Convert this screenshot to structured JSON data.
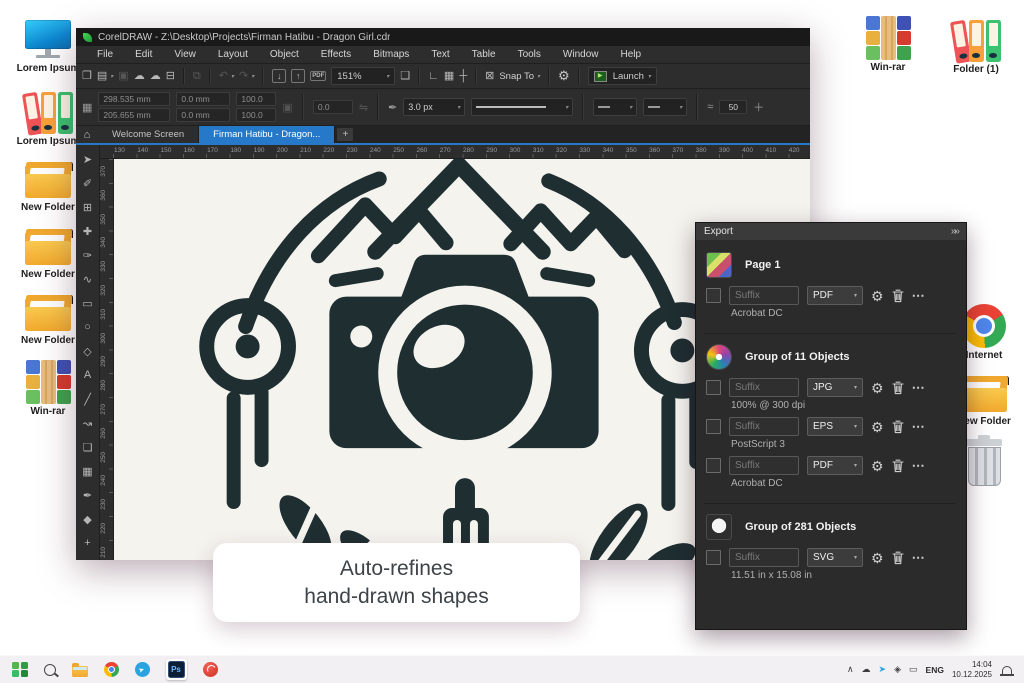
{
  "colors": {
    "artwork": "#1e2e31",
    "canvas_bg": "#f4f3ee",
    "accent_blue": "#2579c8",
    "active_tab": "#2579c8"
  },
  "desktop": {
    "left_icons": [
      {
        "type": "monitor",
        "label": "Lorem Ipsum"
      },
      {
        "type": "binders",
        "label": "Lorem Ipsum"
      },
      {
        "type": "folder",
        "label": "New Folder"
      },
      {
        "type": "folder",
        "label": "New Folder"
      },
      {
        "type": "folder",
        "label": "New Folder"
      },
      {
        "type": "winrar",
        "label": "Win-rar"
      }
    ],
    "top_right_icons": [
      {
        "type": "winrar",
        "label": "Win-rar"
      },
      {
        "type": "binders",
        "label": "Folder (1)"
      }
    ],
    "right_icons": [
      {
        "type": "chrome",
        "label": "Internet"
      },
      {
        "type": "folder",
        "label": "New Folder"
      },
      {
        "type": "trash",
        "label": ""
      }
    ]
  },
  "corel": {
    "title": "CorelDRAW - Z:\\Desktop\\Projects\\Firman Hatibu - Dragon Girl.cdr",
    "menu_items": [
      "File",
      "Edit",
      "View",
      "Layout",
      "Object",
      "Effects",
      "Bitmaps",
      "Text",
      "Table",
      "Tools",
      "Window",
      "Help"
    ],
    "toolbar_icons_left": [
      {
        "name": "new-document-icon",
        "glyph": "❐"
      },
      {
        "name": "open-icon",
        "glyph": "▤",
        "caret": true
      },
      {
        "name": "save-icon",
        "glyph": "▣",
        "dim": true
      },
      {
        "name": "cloud-upload-icon",
        "glyph": "☁"
      },
      {
        "name": "cloud-download-icon",
        "glyph": "☁"
      },
      {
        "name": "print-icon",
        "glyph": "⊟"
      },
      {
        "name": "sep"
      },
      {
        "name": "copy-icon",
        "glyph": "⧉",
        "dim": true
      },
      {
        "name": "sep"
      },
      {
        "name": "undo-icon",
        "glyph": "↶",
        "dim": true,
        "caret": true
      },
      {
        "name": "redo-icon",
        "glyph": "↷",
        "dim": true,
        "caret": true
      },
      {
        "name": "sep"
      },
      {
        "name": "import-icon",
        "glyph": "↓",
        "boxed": true
      },
      {
        "name": "export-icon",
        "glyph": "↑",
        "boxed": true
      },
      {
        "name": "pdf-share-icon",
        "glyph": "PDF",
        "pdf": true
      }
    ],
    "toolbar_icons_view": [
      {
        "name": "fullscreen-icon",
        "glyph": "❑"
      },
      {
        "name": "sep"
      },
      {
        "name": "rulers-toggle-icon",
        "glyph": "∟"
      },
      {
        "name": "grid-toggle-icon",
        "glyph": "▦"
      },
      {
        "name": "guidelines-toggle-icon",
        "glyph": "┼"
      },
      {
        "name": "sep"
      },
      {
        "name": "snap-off-icon",
        "glyph": "⊠"
      }
    ],
    "toolbar": {
      "zoom_level": "151%",
      "snap_label": "Snap To",
      "launch_label": "Launch"
    },
    "property_bar": {
      "object_pos_x": "298.535 mm",
      "object_pos_y": "205.655 mm",
      "object_size_w": "0.0 mm",
      "object_size_h": "0.0 mm",
      "scale_x": "100.0",
      "scale_y": "100.0",
      "rotation_angle": "0.0",
      "outline_width": "3.0 px",
      "smoothing_value": "50"
    },
    "tabs": {
      "welcome": "Welcome Screen",
      "document": "Firman Hatibu - Dragon..."
    },
    "toolbox": [
      {
        "name": "pick-tool",
        "glyph": "➤"
      },
      {
        "name": "shape-tool",
        "glyph": "✐"
      },
      {
        "name": "crop-tool",
        "glyph": "⊞"
      },
      {
        "name": "pan-tool",
        "glyph": "✚"
      },
      {
        "name": "freehand-tool",
        "glyph": "✑"
      },
      {
        "name": "curve-tool",
        "glyph": "∿"
      },
      {
        "name": "rectangle-tool",
        "glyph": "▭"
      },
      {
        "name": "ellipse-tool",
        "glyph": "○"
      },
      {
        "name": "polygon-tool",
        "glyph": "◇"
      },
      {
        "name": "text-tool",
        "glyph": "A"
      },
      {
        "name": "line-tool",
        "glyph": "╱"
      },
      {
        "name": "connector-tool",
        "glyph": "↝"
      },
      {
        "name": "shadow-tool",
        "glyph": "❏"
      },
      {
        "name": "transparency-tool",
        "glyph": "▦"
      },
      {
        "name": "eyedropper-tool",
        "glyph": "✒"
      },
      {
        "name": "fill-tool",
        "glyph": "◆"
      },
      {
        "name": "add-tool",
        "glyph": "+"
      }
    ],
    "ruler_h_labels": [
      "130",
      "140",
      "150",
      "160",
      "170",
      "180",
      "190",
      "200",
      "210",
      "220",
      "230",
      "240",
      "250",
      "260",
      "270",
      "280",
      "290",
      "300",
      "310",
      "320",
      "330",
      "340",
      "350",
      "360",
      "370",
      "380",
      "390",
      "400",
      "410",
      "420"
    ],
    "ruler_v_labels": [
      "370",
      "360",
      "350",
      "340",
      "330",
      "320",
      "310",
      "300",
      "290",
      "280",
      "270",
      "260",
      "250",
      "240",
      "230",
      "220",
      "210"
    ]
  },
  "export_panel": {
    "title": "Export",
    "collapse_glyph": "»»",
    "groups": [
      {
        "name": "Page 1",
        "rows": [
          {
            "suffix_placeholder": "Suffix",
            "format": "PDF",
            "detail": "Acrobat DC"
          }
        ]
      },
      {
        "name": "Group of 11 Objects",
        "rows": [
          {
            "suffix_placeholder": "Suffix",
            "format": "JPG",
            "detail": "100% @ 300 dpi"
          },
          {
            "suffix_placeholder": "Suffix",
            "format": "EPS",
            "detail": "PostScript 3"
          },
          {
            "suffix_placeholder": "Suffix",
            "format": "PDF",
            "detail": "Acrobat DC"
          }
        ]
      },
      {
        "name": "Group of 281 Objects",
        "rows": [
          {
            "suffix_placeholder": "Suffix",
            "format": "SVG",
            "detail": "11.51 in x 15.08 in"
          }
        ]
      }
    ]
  },
  "tooltip": {
    "line1": "Auto-refines",
    "line2": "hand-drawn shapes"
  },
  "taskbar": {
    "apps": [
      {
        "type": "start",
        "name": "start-button"
      },
      {
        "type": "search",
        "name": "search-button"
      },
      {
        "type": "explorer",
        "name": "file-explorer-button"
      },
      {
        "type": "chrome",
        "name": "chrome-button"
      },
      {
        "type": "telegram",
        "name": "telegram-button"
      },
      {
        "type": "photoshop",
        "name": "photoshop-button",
        "active": true
      },
      {
        "type": "redapp",
        "name": "coreldraw-app-button"
      }
    ],
    "tray_icons": [
      {
        "name": "tray-expand-icon",
        "glyph": "∧"
      },
      {
        "name": "onedrive-icon",
        "glyph": "☁"
      },
      {
        "name": "telegram-tray-icon",
        "glyph": "➤"
      },
      {
        "name": "tray-app-icon",
        "glyph": "◈"
      },
      {
        "name": "display-icon",
        "glyph": "▭"
      }
    ],
    "language": "ENG",
    "time": "14:04",
    "date": "10.12.2025"
  }
}
